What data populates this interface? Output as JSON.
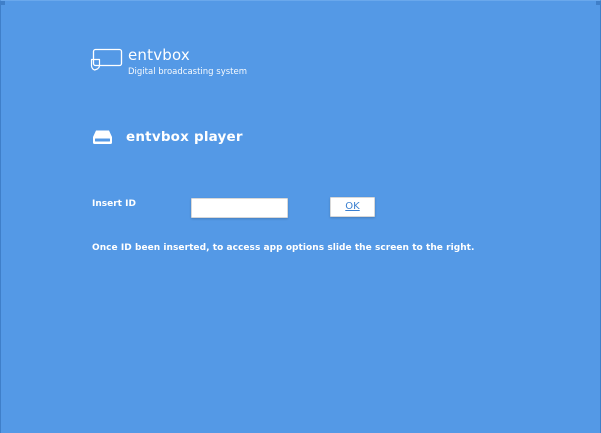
{
  "brand": {
    "name": "entvbox",
    "tagline": "Digital broadcasting system",
    "icon": "display-icon"
  },
  "player": {
    "title": "entvbox player",
    "icon": "drive-icon"
  },
  "form": {
    "id_label": "Insert ID",
    "id_value": "",
    "id_placeholder": "",
    "ok_label": "OK"
  },
  "hint": {
    "text": "Once ID been inserted, to access app options slide the screen to the right."
  },
  "colors": {
    "background": "#5499e6",
    "text": "#ffffff",
    "button_text": "#3a7fd0"
  }
}
